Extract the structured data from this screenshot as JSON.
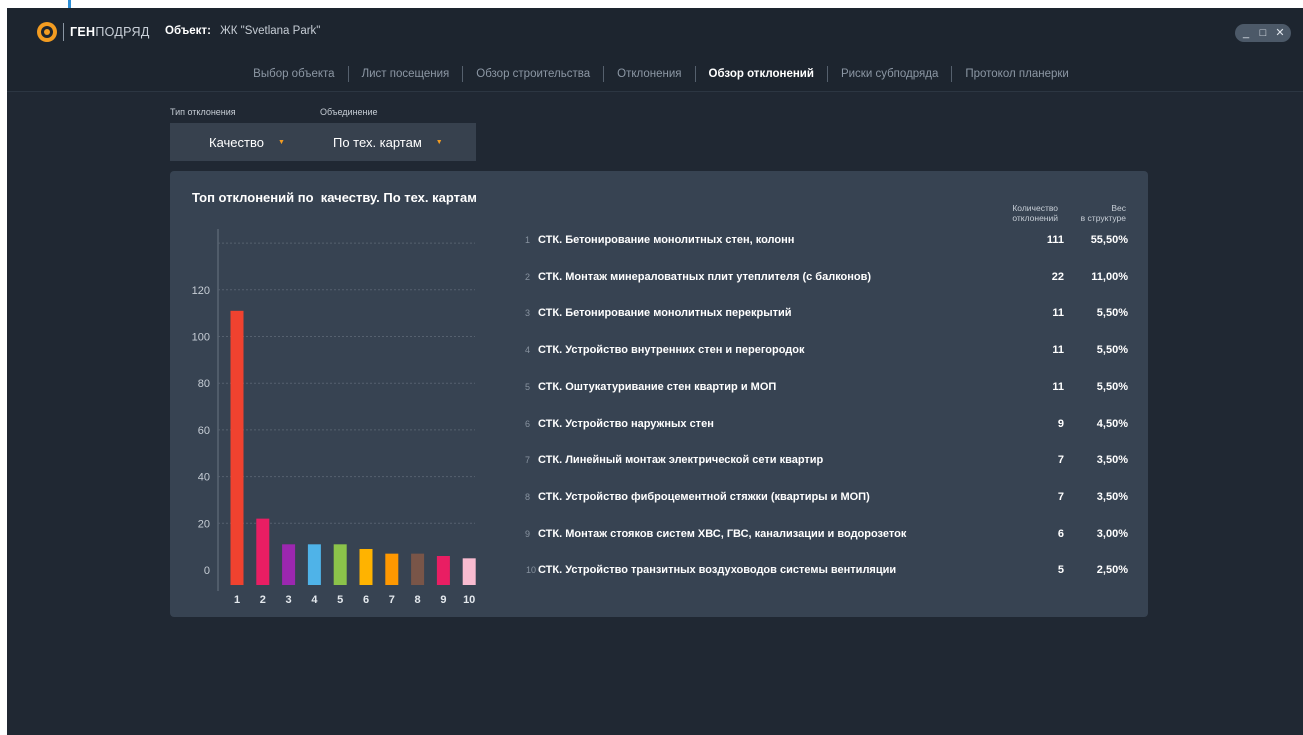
{
  "app": {
    "logo_part1": "ГЕН",
    "logo_part2": "ПОДРЯД",
    "object_label": "Объект:",
    "object_value": "ЖК \"Svetlana Park\""
  },
  "window_controls": {
    "minimize": "_",
    "maximize": "□",
    "close": "✕"
  },
  "tabs": [
    {
      "label": "Выбор объекта",
      "active": false
    },
    {
      "label": "Лист посещения",
      "active": false
    },
    {
      "label": "Обзор строительства",
      "active": false
    },
    {
      "label": "Отклонения",
      "active": false
    },
    {
      "label": "Обзор отклонений",
      "active": true
    },
    {
      "label": "Риски субподряда",
      "active": false
    },
    {
      "label": "Протокол планерки",
      "active": false
    }
  ],
  "filters": {
    "type_label": "Тип отклонения",
    "type_value": "Качество",
    "group_label": "Объединение",
    "group_value": "По тех. картам",
    "arrow": "▼"
  },
  "card": {
    "title": "Топ отклонений по  качеству. По тех. картам",
    "col_count_header_1": "Количество",
    "col_count_header_2": "отклонений",
    "col_weight_header_1": "Вес",
    "col_weight_header_2": "в структуре"
  },
  "rows": [
    {
      "num": "1",
      "name": "СТК. Бетонирование монолитных стен, колонн",
      "count": "111",
      "weight": "55,50%"
    },
    {
      "num": "2",
      "name": "СТК. Монтаж минераловатных плит утеплителя (с балконов)",
      "count": "22",
      "weight": "11,00%"
    },
    {
      "num": "3",
      "name": "СТК. Бетонирование монолитных перекрытий",
      "count": "11",
      "weight": "5,50%"
    },
    {
      "num": "4",
      "name": "СТК. Устройство внутренних стен и перегородок",
      "count": "11",
      "weight": "5,50%"
    },
    {
      "num": "5",
      "name": "СТК. Оштукатуривание стен квартир и МОП",
      "count": "11",
      "weight": "5,50%"
    },
    {
      "num": "6",
      "name": "СТК. Устройство наружных стен",
      "count": "9",
      "weight": "4,50%"
    },
    {
      "num": "7",
      "name": "СТК. Линейный монтаж электрической сети квартир",
      "count": "7",
      "weight": "3,50%"
    },
    {
      "num": "8",
      "name": "СТК. Устройство фиброцементной стяжки (квартиры и МОП)",
      "count": "7",
      "weight": "3,50%"
    },
    {
      "num": "9",
      "name": "СТК. Монтаж стояков систем ХВС, ГВС, канализации и водорозеток",
      "count": "6",
      "weight": "3,00%"
    },
    {
      "num": "10",
      "name": "СТК. Устройство транзитных воздуховодов системы вентиляции",
      "count": "5",
      "weight": "2,50%"
    }
  ],
  "chart_data": {
    "type": "bar",
    "categories": [
      "1",
      "2",
      "3",
      "4",
      "5",
      "6",
      "7",
      "8",
      "9",
      "10"
    ],
    "values": [
      111,
      22,
      11,
      11,
      11,
      9,
      7,
      7,
      6,
      5
    ],
    "colors": [
      "#f0422f",
      "#e91e63",
      "#9c27b0",
      "#4fb3e8",
      "#8bc34a",
      "#ffb300",
      "#ff9800",
      "#795548",
      "#e91e63",
      "#f8bbd0"
    ],
    "yticks": [
      0,
      20,
      40,
      60,
      80,
      100,
      120
    ],
    "ylim": [
      0,
      140
    ],
    "grid": true
  }
}
